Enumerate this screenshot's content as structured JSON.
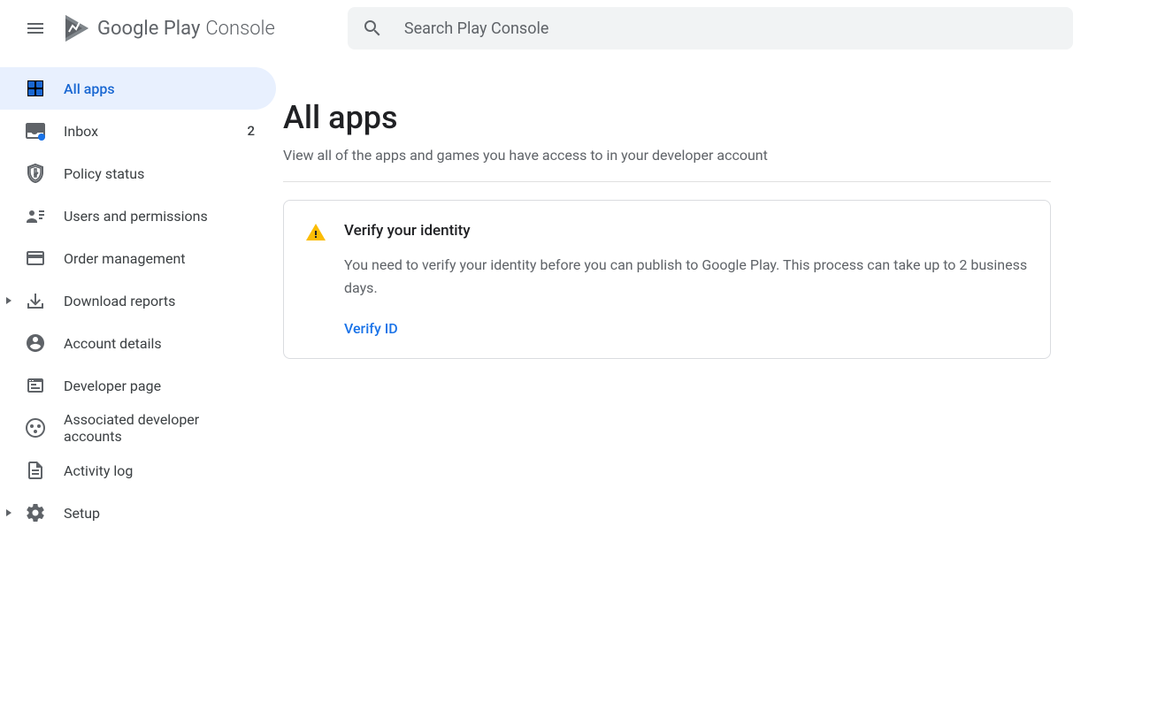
{
  "header": {
    "logo_text_1": "Google Play",
    "logo_text_2": "Console",
    "search_placeholder": "Search Play Console"
  },
  "sidebar": {
    "items": [
      {
        "label": "All apps",
        "badge": ""
      },
      {
        "label": "Inbox",
        "badge": "2"
      },
      {
        "label": "Policy status",
        "badge": ""
      },
      {
        "label": "Users and permissions",
        "badge": ""
      },
      {
        "label": "Order management",
        "badge": ""
      },
      {
        "label": "Download reports",
        "badge": ""
      },
      {
        "label": "Account details",
        "badge": ""
      },
      {
        "label": "Developer page",
        "badge": ""
      },
      {
        "label": "Associated developer accounts",
        "badge": ""
      },
      {
        "label": "Activity log",
        "badge": ""
      },
      {
        "label": "Setup",
        "badge": ""
      }
    ]
  },
  "main": {
    "title": "All apps",
    "subtitle": "View all of the apps and games you have access to in your developer account",
    "alert": {
      "title": "Verify your identity",
      "text": "You need to verify your identity before you can publish to Google Play. This process can take up to 2 business days.",
      "link": "Verify ID"
    }
  }
}
